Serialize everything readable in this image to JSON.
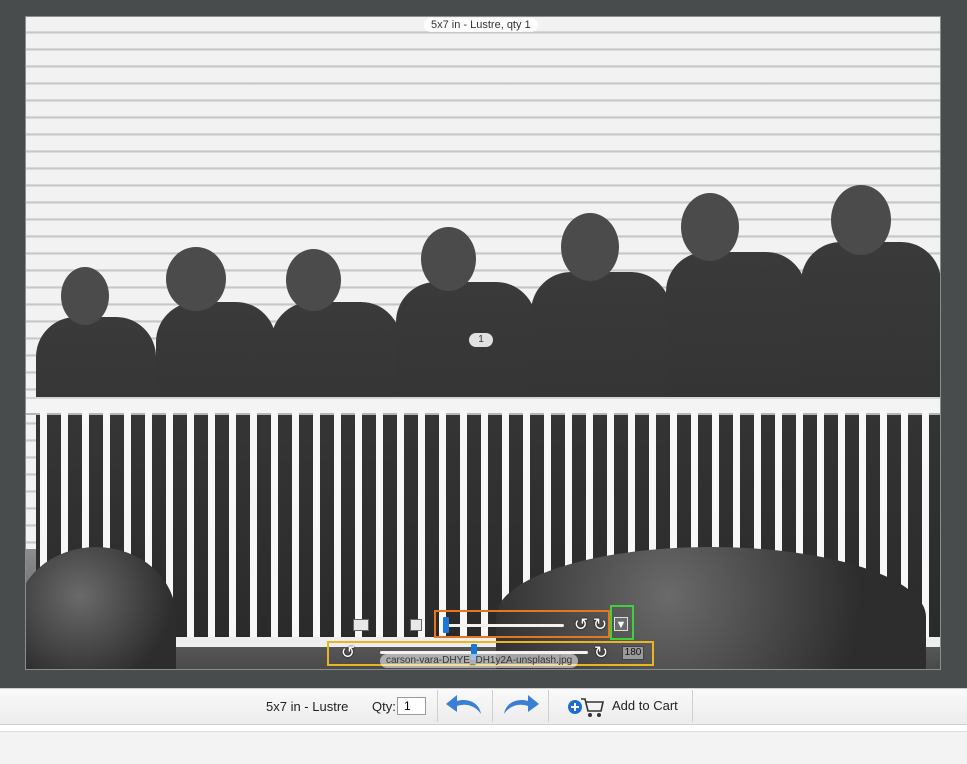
{
  "preview": {
    "title": "5x7 in - Lustre, qty 1",
    "page_badge": "1",
    "filename": "carson-vara-DHYE_DH1y2A-unsplash.jpg",
    "rotation_angle": "180"
  },
  "toolbar": {
    "product": "5x7 in - Lustre",
    "qty_label": "Qty:",
    "qty_value": "1",
    "add_to_cart_label": "Add to Cart"
  },
  "colors": {
    "canvas_bg": "#484c4c",
    "highlight_orange": "#e8761d",
    "highlight_green": "#3ed13e",
    "highlight_yellow": "#e8b623",
    "accent_blue": "#1c78d4"
  },
  "icons": [
    "undo-icon",
    "redo-icon",
    "add-to-cart-icon",
    "rotate-left-icon",
    "rotate-right-icon",
    "dropdown-arrow-icon"
  ]
}
